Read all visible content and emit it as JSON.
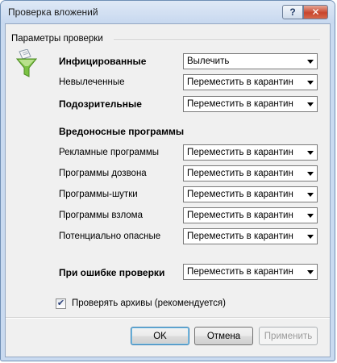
{
  "window": {
    "title": "Проверка вложений",
    "help_glyph": "?",
    "close_glyph": "✕"
  },
  "group": {
    "label": "Параметры проверки"
  },
  "rows": [
    {
      "label": "Инфицированные",
      "value": "Вылечить"
    },
    {
      "label": "Невылеченные",
      "value": "Переместить в карантин"
    },
    {
      "label": "Подозрительные",
      "value": "Переместить в карантин"
    }
  ],
  "malware": {
    "heading": "Вредоносные программы",
    "rows": [
      {
        "label": "Рекламные программы",
        "value": "Переместить в карантин"
      },
      {
        "label": "Программы дозвона",
        "value": "Переместить в карантин"
      },
      {
        "label": "Программы-шутки",
        "value": "Переместить в карантин"
      },
      {
        "label": "Программы взлома",
        "value": "Переместить в карантин"
      },
      {
        "label": "Потенциально опасные",
        "value": "Переместить в карантин"
      }
    ]
  },
  "error_row": {
    "label": "При ошибке проверки",
    "value": "Переместить в карантин"
  },
  "archives": {
    "label": "Проверять архивы (рекомендуется)",
    "checked": true,
    "glyph": "✔"
  },
  "buttons": {
    "ok": "OK",
    "cancel": "Отмена",
    "apply": "Применить"
  },
  "colors": {
    "accent": "#3c7fb1",
    "funnel": "#7ac143"
  }
}
